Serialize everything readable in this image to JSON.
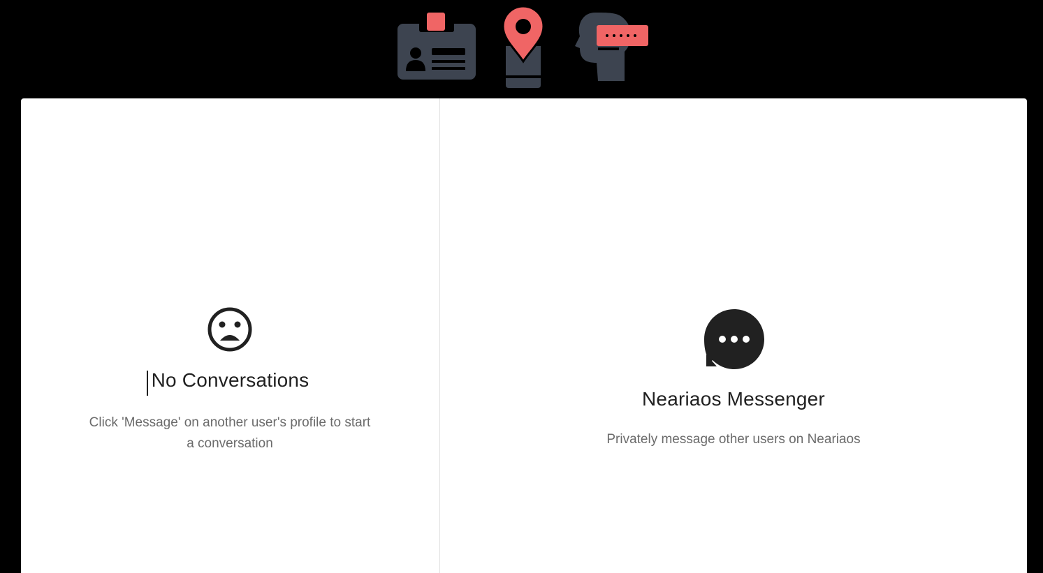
{
  "header": {
    "icons": [
      "id-card-icon",
      "map-pin-icon",
      "head-password-icon"
    ],
    "colors": {
      "accent": "#f06565",
      "icon_dark": "#3d4450",
      "background": "#000000"
    }
  },
  "conversations": {
    "empty_icon": "sad-face-icon",
    "empty_title": "No Conversations",
    "empty_message": "Click 'Message' on another user's profile to start a conversation"
  },
  "messenger": {
    "icon": "chat-bubble-icon",
    "title": "Neariaos Messenger",
    "subtitle": "Privately message other users on Neariaos"
  }
}
